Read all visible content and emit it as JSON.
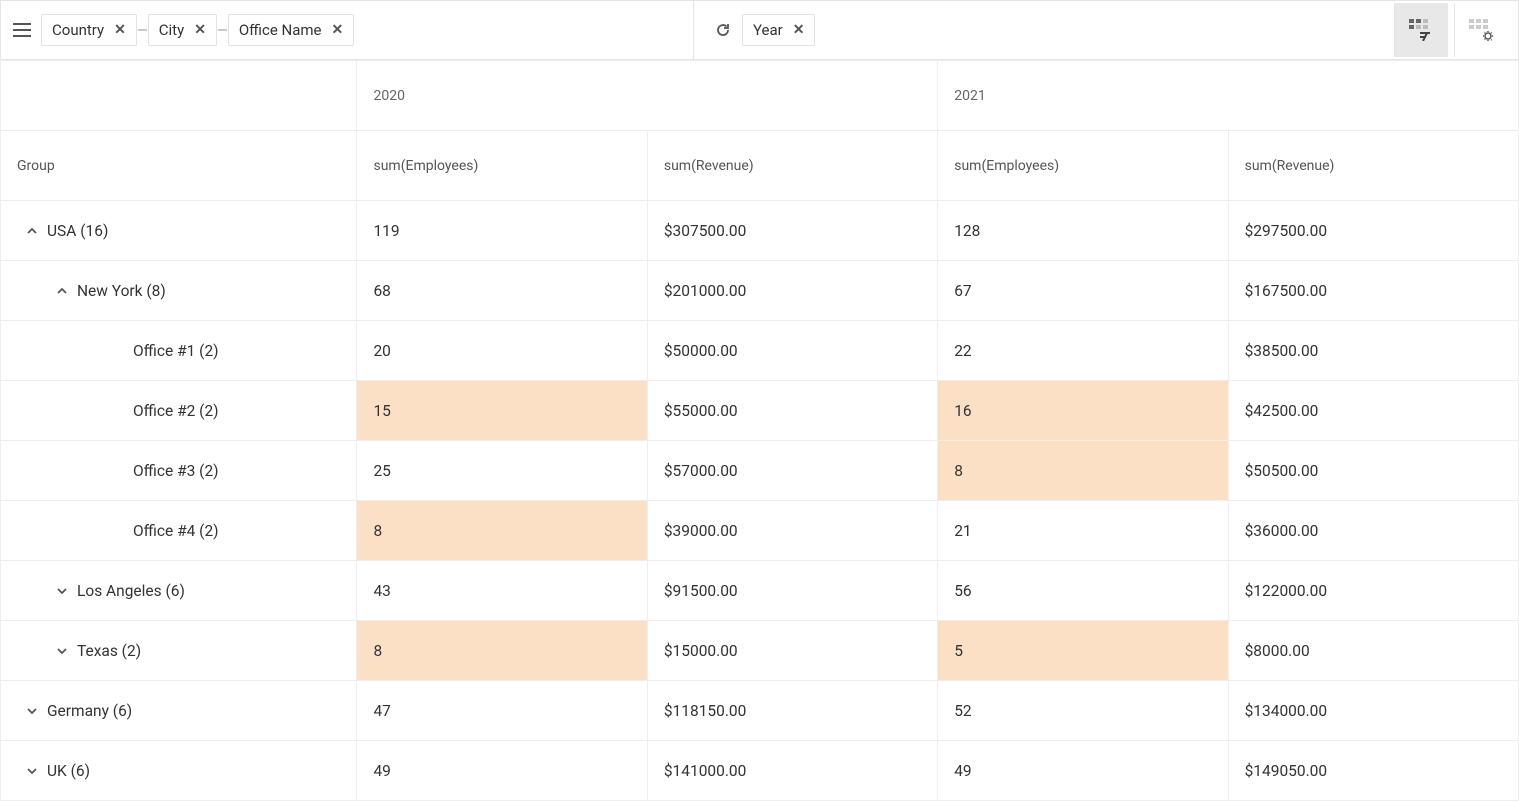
{
  "toolbar": {
    "row_dims": [
      "Country",
      "City",
      "Office Name"
    ],
    "col_dims": [
      "Year"
    ]
  },
  "headers": {
    "group": "Group",
    "years": [
      "2020",
      "2021"
    ],
    "metrics": [
      "sum(Employees)",
      "sum(Revenue)"
    ]
  },
  "rows": [
    {
      "label": "USA (16)",
      "indent": 0,
      "expanded": true,
      "hasChildren": true,
      "vals": [
        {
          "v": "119",
          "hl": false
        },
        {
          "v": "$307500.00",
          "hl": false
        },
        {
          "v": "128",
          "hl": false
        },
        {
          "v": "$297500.00",
          "hl": false
        }
      ]
    },
    {
      "label": "New York (8)",
      "indent": 1,
      "expanded": true,
      "hasChildren": true,
      "vals": [
        {
          "v": "68",
          "hl": false
        },
        {
          "v": "$201000.00",
          "hl": false
        },
        {
          "v": "67",
          "hl": false
        },
        {
          "v": "$167500.00",
          "hl": false
        }
      ]
    },
    {
      "label": "Office #1 (2)",
      "indent": 2,
      "expanded": false,
      "hasChildren": false,
      "vals": [
        {
          "v": "20",
          "hl": false
        },
        {
          "v": "$50000.00",
          "hl": false
        },
        {
          "v": "22",
          "hl": false
        },
        {
          "v": "$38500.00",
          "hl": false
        }
      ]
    },
    {
      "label": "Office #2 (2)",
      "indent": 2,
      "expanded": false,
      "hasChildren": false,
      "vals": [
        {
          "v": "15",
          "hl": true
        },
        {
          "v": "$55000.00",
          "hl": false
        },
        {
          "v": "16",
          "hl": true
        },
        {
          "v": "$42500.00",
          "hl": false
        }
      ]
    },
    {
      "label": "Office #3 (2)",
      "indent": 2,
      "expanded": false,
      "hasChildren": false,
      "vals": [
        {
          "v": "25",
          "hl": false
        },
        {
          "v": "$57000.00",
          "hl": false
        },
        {
          "v": "8",
          "hl": true
        },
        {
          "v": "$50500.00",
          "hl": false
        }
      ]
    },
    {
      "label": "Office #4 (2)",
      "indent": 2,
      "expanded": false,
      "hasChildren": false,
      "vals": [
        {
          "v": "8",
          "hl": true
        },
        {
          "v": "$39000.00",
          "hl": false
        },
        {
          "v": "21",
          "hl": false
        },
        {
          "v": "$36000.00",
          "hl": false
        }
      ]
    },
    {
      "label": "Los Angeles (6)",
      "indent": 1,
      "expanded": false,
      "hasChildren": true,
      "vals": [
        {
          "v": "43",
          "hl": false
        },
        {
          "v": "$91500.00",
          "hl": false
        },
        {
          "v": "56",
          "hl": false
        },
        {
          "v": "$122000.00",
          "hl": false
        }
      ]
    },
    {
      "label": "Texas (2)",
      "indent": 1,
      "expanded": false,
      "hasChildren": true,
      "vals": [
        {
          "v": "8",
          "hl": true
        },
        {
          "v": "$15000.00",
          "hl": false
        },
        {
          "v": "5",
          "hl": true
        },
        {
          "v": "$8000.00",
          "hl": false
        }
      ]
    },
    {
      "label": "Germany (6)",
      "indent": 0,
      "expanded": false,
      "hasChildren": true,
      "vals": [
        {
          "v": "47",
          "hl": false
        },
        {
          "v": "$118150.00",
          "hl": false
        },
        {
          "v": "52",
          "hl": false
        },
        {
          "v": "$134000.00",
          "hl": false
        }
      ]
    },
    {
      "label": "UK (6)",
      "indent": 0,
      "expanded": false,
      "hasChildren": true,
      "vals": [
        {
          "v": "49",
          "hl": false
        },
        {
          "v": "$141000.00",
          "hl": false
        },
        {
          "v": "49",
          "hl": false
        },
        {
          "v": "$149050.00",
          "hl": false
        }
      ]
    }
  ]
}
